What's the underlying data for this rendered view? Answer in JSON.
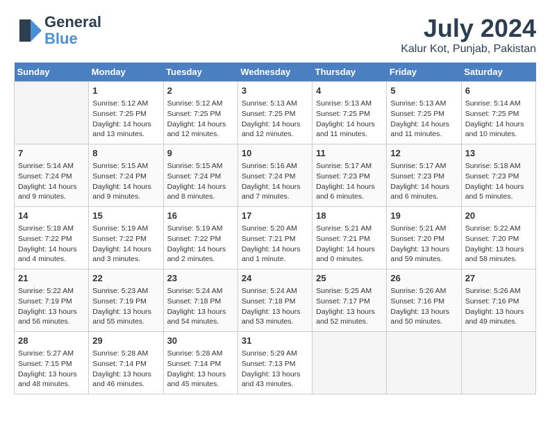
{
  "header": {
    "logo_line1": "General",
    "logo_line2": "Blue",
    "month": "July 2024",
    "location": "Kalur Kot, Punjab, Pakistan"
  },
  "days_of_week": [
    "Sunday",
    "Monday",
    "Tuesday",
    "Wednesday",
    "Thursday",
    "Friday",
    "Saturday"
  ],
  "weeks": [
    [
      {
        "day": "",
        "info": ""
      },
      {
        "day": "1",
        "info": "Sunrise: 5:12 AM\nSunset: 7:25 PM\nDaylight: 14 hours\nand 13 minutes."
      },
      {
        "day": "2",
        "info": "Sunrise: 5:12 AM\nSunset: 7:25 PM\nDaylight: 14 hours\nand 12 minutes."
      },
      {
        "day": "3",
        "info": "Sunrise: 5:13 AM\nSunset: 7:25 PM\nDaylight: 14 hours\nand 12 minutes."
      },
      {
        "day": "4",
        "info": "Sunrise: 5:13 AM\nSunset: 7:25 PM\nDaylight: 14 hours\nand 11 minutes."
      },
      {
        "day": "5",
        "info": "Sunrise: 5:13 AM\nSunset: 7:25 PM\nDaylight: 14 hours\nand 11 minutes."
      },
      {
        "day": "6",
        "info": "Sunrise: 5:14 AM\nSunset: 7:25 PM\nDaylight: 14 hours\nand 10 minutes."
      }
    ],
    [
      {
        "day": "7",
        "info": "Sunrise: 5:14 AM\nSunset: 7:24 PM\nDaylight: 14 hours\nand 9 minutes."
      },
      {
        "day": "8",
        "info": "Sunrise: 5:15 AM\nSunset: 7:24 PM\nDaylight: 14 hours\nand 9 minutes."
      },
      {
        "day": "9",
        "info": "Sunrise: 5:15 AM\nSunset: 7:24 PM\nDaylight: 14 hours\nand 8 minutes."
      },
      {
        "day": "10",
        "info": "Sunrise: 5:16 AM\nSunset: 7:24 PM\nDaylight: 14 hours\nand 7 minutes."
      },
      {
        "day": "11",
        "info": "Sunrise: 5:17 AM\nSunset: 7:23 PM\nDaylight: 14 hours\nand 6 minutes."
      },
      {
        "day": "12",
        "info": "Sunrise: 5:17 AM\nSunset: 7:23 PM\nDaylight: 14 hours\nand 6 minutes."
      },
      {
        "day": "13",
        "info": "Sunrise: 5:18 AM\nSunset: 7:23 PM\nDaylight: 14 hours\nand 5 minutes."
      }
    ],
    [
      {
        "day": "14",
        "info": "Sunrise: 5:18 AM\nSunset: 7:22 PM\nDaylight: 14 hours\nand 4 minutes."
      },
      {
        "day": "15",
        "info": "Sunrise: 5:19 AM\nSunset: 7:22 PM\nDaylight: 14 hours\nand 3 minutes."
      },
      {
        "day": "16",
        "info": "Sunrise: 5:19 AM\nSunset: 7:22 PM\nDaylight: 14 hours\nand 2 minutes."
      },
      {
        "day": "17",
        "info": "Sunrise: 5:20 AM\nSunset: 7:21 PM\nDaylight: 14 hours\nand 1 minute."
      },
      {
        "day": "18",
        "info": "Sunrise: 5:21 AM\nSunset: 7:21 PM\nDaylight: 14 hours\nand 0 minutes."
      },
      {
        "day": "19",
        "info": "Sunrise: 5:21 AM\nSunset: 7:20 PM\nDaylight: 13 hours\nand 59 minutes."
      },
      {
        "day": "20",
        "info": "Sunrise: 5:22 AM\nSunset: 7:20 PM\nDaylight: 13 hours\nand 58 minutes."
      }
    ],
    [
      {
        "day": "21",
        "info": "Sunrise: 5:22 AM\nSunset: 7:19 PM\nDaylight: 13 hours\nand 56 minutes."
      },
      {
        "day": "22",
        "info": "Sunrise: 5:23 AM\nSunset: 7:19 PM\nDaylight: 13 hours\nand 55 minutes."
      },
      {
        "day": "23",
        "info": "Sunrise: 5:24 AM\nSunset: 7:18 PM\nDaylight: 13 hours\nand 54 minutes."
      },
      {
        "day": "24",
        "info": "Sunrise: 5:24 AM\nSunset: 7:18 PM\nDaylight: 13 hours\nand 53 minutes."
      },
      {
        "day": "25",
        "info": "Sunrise: 5:25 AM\nSunset: 7:17 PM\nDaylight: 13 hours\nand 52 minutes."
      },
      {
        "day": "26",
        "info": "Sunrise: 5:26 AM\nSunset: 7:16 PM\nDaylight: 13 hours\nand 50 minutes."
      },
      {
        "day": "27",
        "info": "Sunrise: 5:26 AM\nSunset: 7:16 PM\nDaylight: 13 hours\nand 49 minutes."
      }
    ],
    [
      {
        "day": "28",
        "info": "Sunrise: 5:27 AM\nSunset: 7:15 PM\nDaylight: 13 hours\nand 48 minutes."
      },
      {
        "day": "29",
        "info": "Sunrise: 5:28 AM\nSunset: 7:14 PM\nDaylight: 13 hours\nand 46 minutes."
      },
      {
        "day": "30",
        "info": "Sunrise: 5:28 AM\nSunset: 7:14 PM\nDaylight: 13 hours\nand 45 minutes."
      },
      {
        "day": "31",
        "info": "Sunrise: 5:29 AM\nSunset: 7:13 PM\nDaylight: 13 hours\nand 43 minutes."
      },
      {
        "day": "",
        "info": ""
      },
      {
        "day": "",
        "info": ""
      },
      {
        "day": "",
        "info": ""
      }
    ]
  ]
}
